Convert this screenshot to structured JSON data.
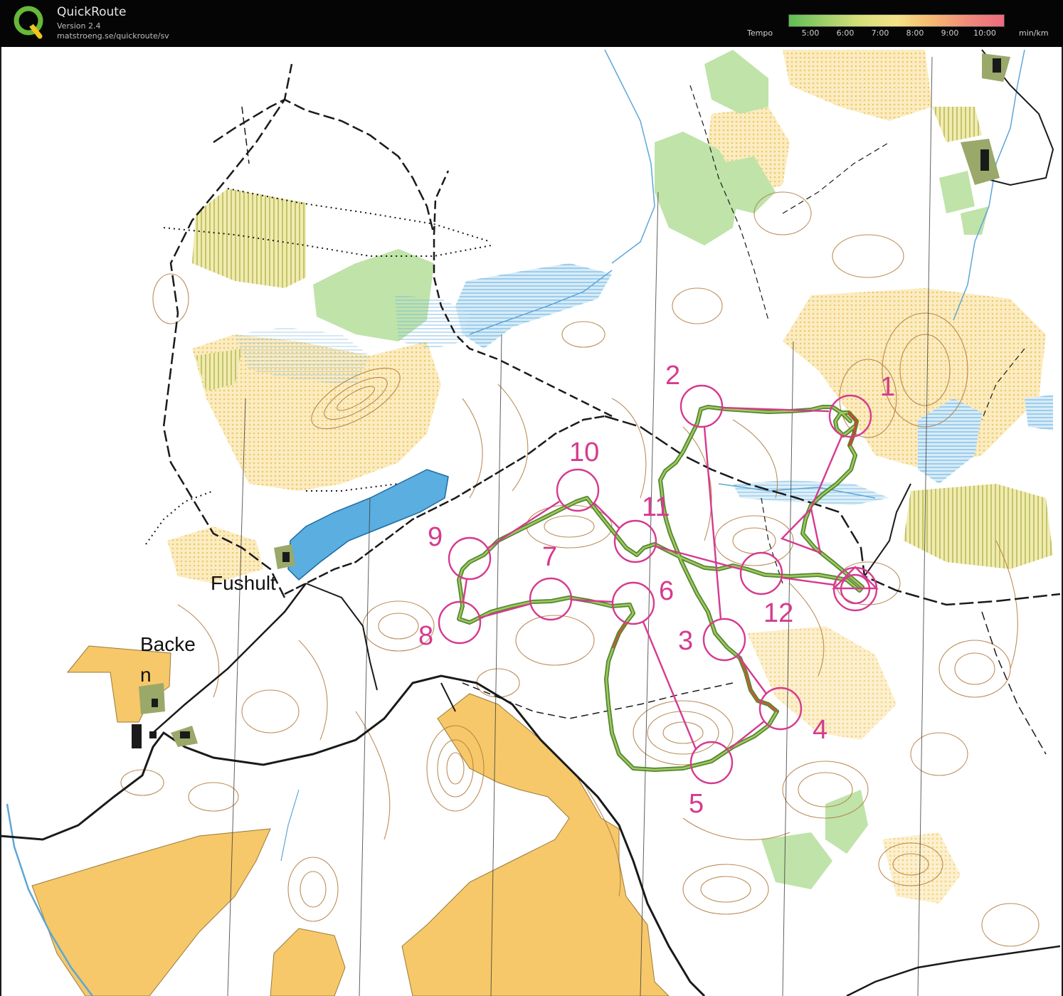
{
  "app": {
    "title": "QuickRoute",
    "version": "Version 2.4",
    "url": "matstroeng.se/quickroute/sv"
  },
  "legend": {
    "label": "Tempo",
    "unit": "min/km",
    "ticks": [
      "5:00",
      "6:00",
      "7:00",
      "8:00",
      "9:00",
      "10:00"
    ],
    "gradient_colors": [
      "#5fbd55",
      "#9fcf6a",
      "#d8df7a",
      "#f3e188",
      "#f6b870",
      "#f08a7c",
      "#ec6b7e"
    ]
  },
  "map": {
    "place_names": [
      "Fushult",
      "Backe",
      "n"
    ],
    "controls": [
      "1",
      "2",
      "3",
      "4",
      "5",
      "6",
      "7",
      "8",
      "9",
      "10",
      "11",
      "12"
    ],
    "colors": {
      "course": "#d63a8f",
      "route_green": "#6b9a3a",
      "route_red": "#d2442d",
      "water": "#5da6d8",
      "open_yellow": "#f5c86a",
      "vegetation_green": "#bde2a6",
      "contour": "#b07a3d"
    }
  }
}
